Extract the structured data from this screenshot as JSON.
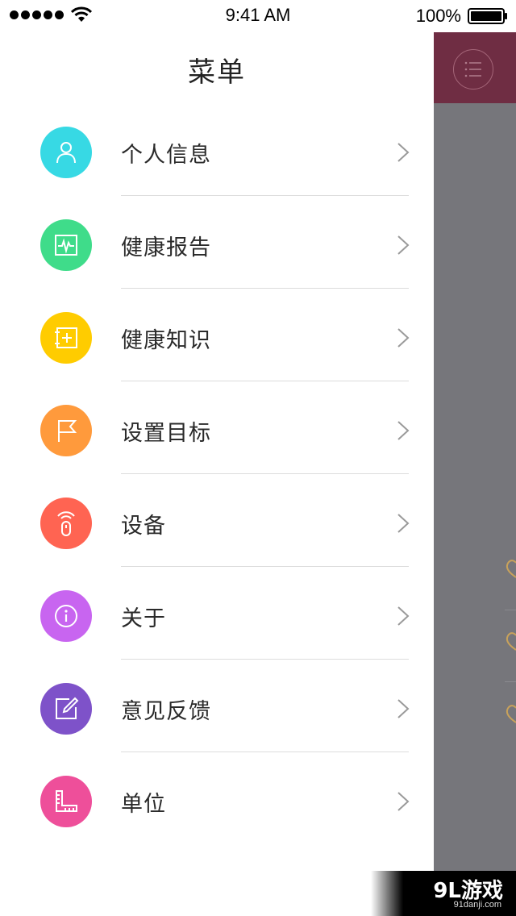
{
  "status_bar": {
    "time": "9:41 AM",
    "battery": "100%",
    "signal_icon": "signal-dots-icon",
    "wifi_icon": "wifi-icon",
    "battery_icon": "battery-icon"
  },
  "drawer": {
    "title": "菜单",
    "items": [
      {
        "label": "个人信息",
        "icon": "person-icon",
        "color": "#37d9e4"
      },
      {
        "label": "健康报告",
        "icon": "heartbeat-monitor-icon",
        "color": "#3fdc8a"
      },
      {
        "label": "健康知识",
        "icon": "plus-book-icon",
        "color": "#ffcc00"
      },
      {
        "label": "设置目标",
        "icon": "flag-icon",
        "color": "#ff9a3c"
      },
      {
        "label": "设备",
        "icon": "device-signal-icon",
        "color": "#ff6452"
      },
      {
        "label": "关于",
        "icon": "info-icon",
        "color": "#c865f0"
      },
      {
        "label": "意见反馈",
        "icon": "edit-icon",
        "color": "#7e52c9"
      },
      {
        "label": "单位",
        "icon": "ruler-icon",
        "color": "#ee4f9a"
      }
    ]
  },
  "backdrop": {
    "header_color": "#6f2d43",
    "menu_icon": "list-menu-icon"
  },
  "watermark": {
    "main": "9L游戏",
    "sub": "91danji.com"
  }
}
